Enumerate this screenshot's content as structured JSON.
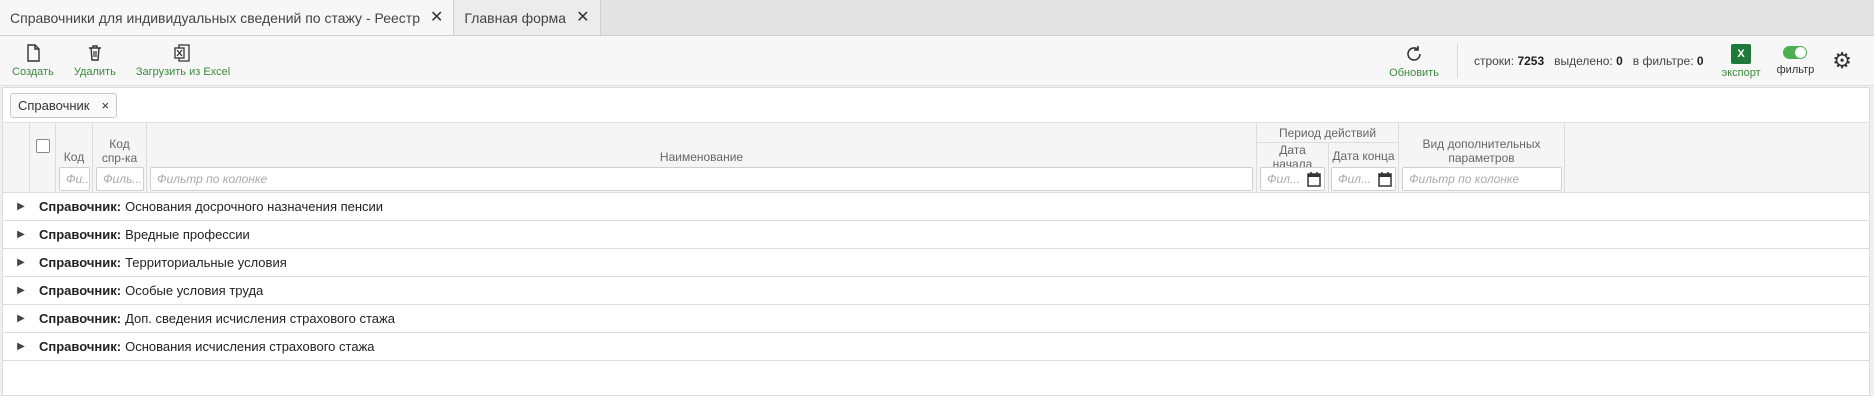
{
  "tabs": [
    {
      "label": "Справочники для индивидуальных сведений по стажу - Реестр",
      "close": "✕"
    },
    {
      "label": "Главная форма",
      "close": "✕"
    }
  ],
  "toolbar": {
    "create": "Создать",
    "delete": "Удалить",
    "load_excel": "Загрузить из Excel",
    "refresh": "Обновить",
    "export": "экспорт",
    "filter": "фильтр",
    "excel_glyph": "X"
  },
  "stats": {
    "rows_label": "строки:",
    "rows_value": "7253",
    "selected_label": "выделено:",
    "selected_value": "0",
    "infilter_label": "в фильтре:",
    "infilter_value": "0"
  },
  "chip": {
    "label": "Справочник",
    "close": "×"
  },
  "columns": {
    "code": "Код",
    "ref_code": "Код спр-ка",
    "name": "Наименование",
    "period": "Период действий",
    "date_start": "Дата начала",
    "date_end": "Дата конца",
    "extra": "Вид дополнительных параметров"
  },
  "filters": {
    "code": "Фи...",
    "ref_code": "Филь...",
    "name": "Фильтр по колонке",
    "date_start": "Фил...",
    "date_end": "Фил...",
    "extra": "Фильтр по колонке"
  },
  "group_prefix": "Справочник:",
  "rows": [
    "Основания досрочного назначения пенсии",
    "Вредные профессии",
    "Территориальные условия",
    "Особые условия труда",
    "Доп. сведения исчисления страхового стажа",
    "Основания исчисления страхового стажа"
  ],
  "colors": {
    "accent": "#3a8a3a",
    "excel": "#1e7a3a",
    "toggle": "#4caf50"
  }
}
